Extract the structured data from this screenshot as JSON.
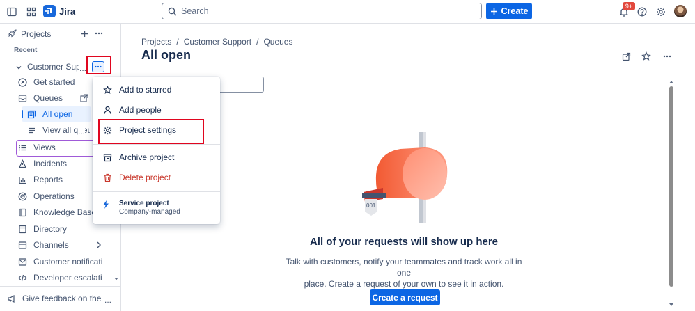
{
  "app": {
    "name": "Jira"
  },
  "topbar": {
    "search_placeholder": "Search",
    "create_label": "Create",
    "notifications_badge": "9+"
  },
  "sidebar": {
    "projects_label": "Projects",
    "recent_label": "Recent",
    "project_name": "Customer Support",
    "items": [
      {
        "label": "Get started",
        "icon": "compass-icon"
      },
      {
        "label": "Queues",
        "icon": "queue-icon"
      },
      {
        "label": "All open",
        "icon": "inbox-icon"
      },
      {
        "label": "View all queues",
        "icon": "list-icon"
      },
      {
        "label": "Views",
        "icon": "views-icon"
      },
      {
        "label": "Incidents",
        "icon": "incidents-icon"
      },
      {
        "label": "Reports",
        "icon": "reports-icon"
      },
      {
        "label": "Operations",
        "icon": "operations-icon"
      },
      {
        "label": "Knowledge Base",
        "icon": "book-icon"
      },
      {
        "label": "Directory",
        "icon": "directory-icon"
      },
      {
        "label": "Channels",
        "icon": "channels-icon"
      },
      {
        "label": "Customer notifications",
        "icon": "notifications-icon"
      },
      {
        "label": "Developer escalations",
        "icon": "code-icon"
      }
    ],
    "feedback_label": "Give feedback on the new navigation"
  },
  "breadcrumb": [
    "Projects",
    "Customer Support",
    "Queues"
  ],
  "page": {
    "title": "All open"
  },
  "empty_state": {
    "title": "All of your requests will show up here",
    "description_line1": "Talk with customers, notify your teammates and track work all in one",
    "description_line2": "place. Create a request of your own to see it in action.",
    "button_label": "Create a request",
    "mailbox_tag": "001"
  },
  "menu": {
    "items": [
      {
        "label": "Add to starred",
        "icon": "star-icon"
      },
      {
        "label": "Add people",
        "icon": "person-icon"
      },
      {
        "label": "Project settings",
        "icon": "gear-icon"
      },
      {
        "label": "Archive project",
        "icon": "archive-icon"
      },
      {
        "label": "Delete project",
        "icon": "trash-icon"
      }
    ],
    "footer_title": "Service project",
    "footer_subtitle": "Company-managed"
  },
  "colors": {
    "accent": "#0c66e4",
    "danger": "#c9372c",
    "highlight_box": "#e0061f",
    "views_outline": "#a05ad8"
  }
}
